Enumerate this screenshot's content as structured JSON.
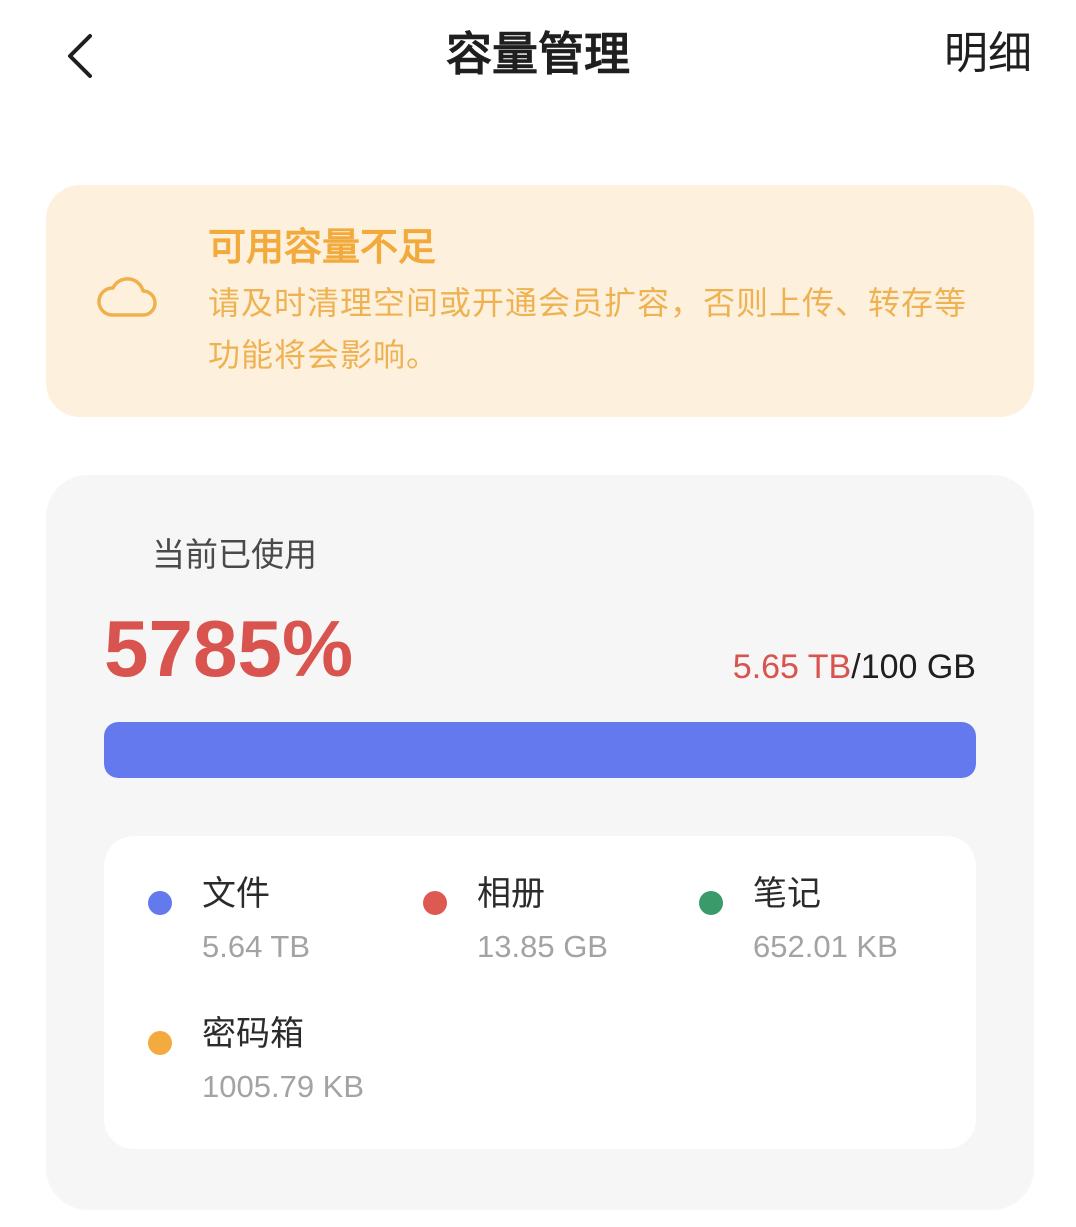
{
  "header": {
    "title": "容量管理",
    "detail_label": "明细",
    "back_icon": "chevron-left-icon"
  },
  "warning": {
    "icon": "cloud-icon",
    "title": "可用容量不足",
    "message": "请及时清理空间或开通会员扩容，否则上传、转存等功能将会影响。",
    "title_color": "#f2aa3c",
    "background": "#fdf1de"
  },
  "usage": {
    "label": "当前已使用",
    "percent_text": "5785%",
    "used": "5.65 TB",
    "separator": "/",
    "total": "100 GB",
    "progress_fraction": 1.0,
    "bar_color": "#6479ee",
    "alert_color": "#d9534f"
  },
  "breakdown": {
    "items": [
      {
        "name": "文件",
        "size": "5.64 TB",
        "color": "#6479ee"
      },
      {
        "name": "相册",
        "size": "13.85 GB",
        "color": "#dd5a52"
      },
      {
        "name": "笔记",
        "size": "652.01 KB",
        "color": "#3a9a6a"
      },
      {
        "name": "密码箱",
        "size": "1005.79 KB",
        "color": "#f3aa3e"
      }
    ]
  }
}
